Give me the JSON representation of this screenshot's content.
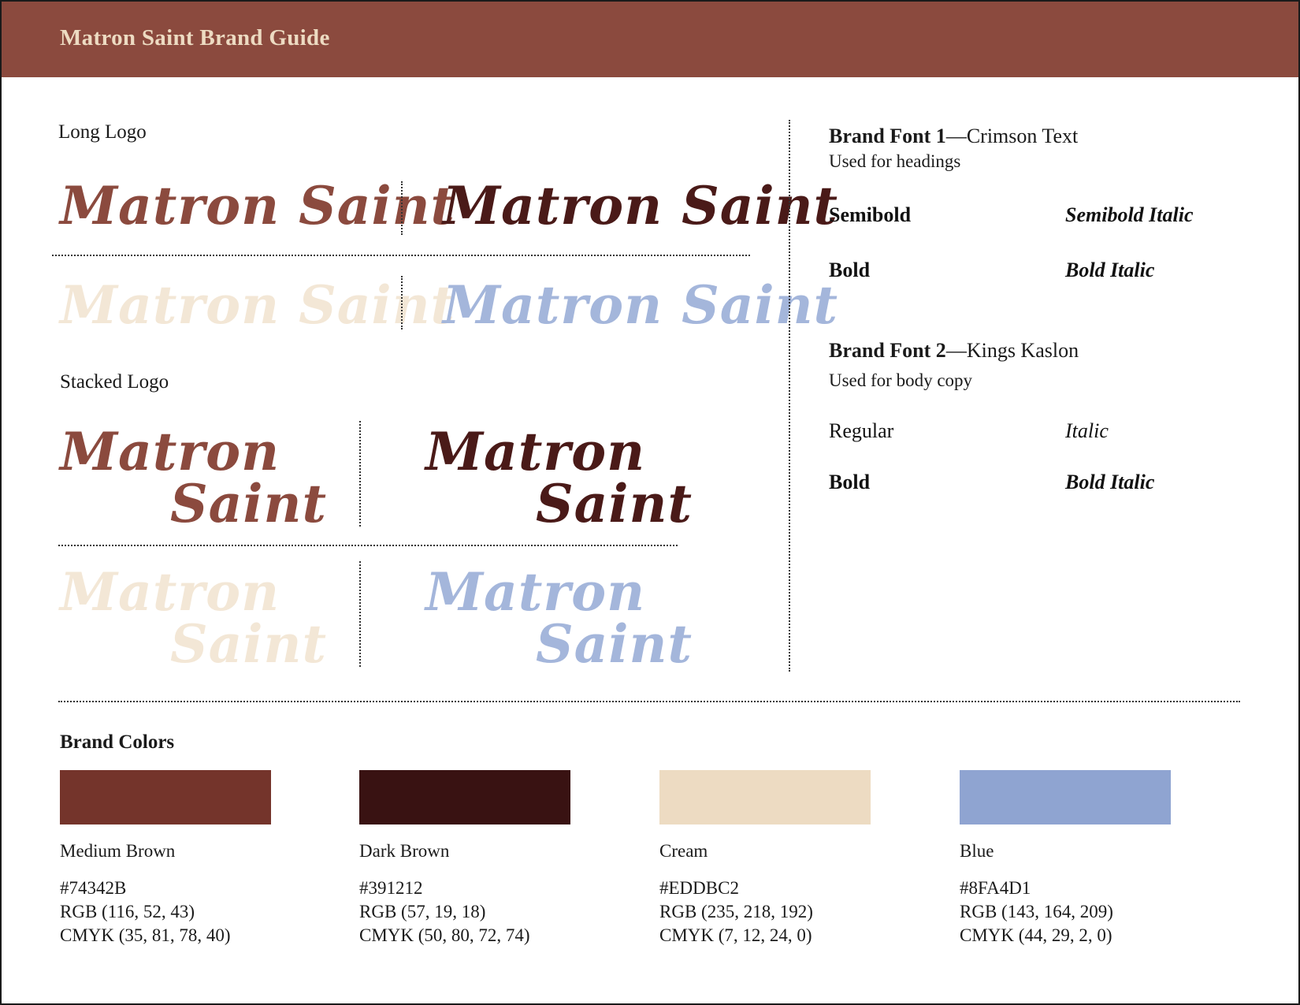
{
  "header": {
    "title": "Matron Saint Brand Guide"
  },
  "long_logo": {
    "label": "Long Logo",
    "text": "Matron Saint",
    "variants": [
      {
        "color": "#8B4A3E"
      },
      {
        "color": "#4A1A18"
      },
      {
        "color": "#F3E7D6"
      },
      {
        "color": "#A4B6DB"
      }
    ]
  },
  "stacked_logo": {
    "label": "Stacked Logo",
    "line1": "Matron",
    "line2": "Saint",
    "variants": [
      {
        "color": "#8B4A3E"
      },
      {
        "color": "#4A1A18"
      },
      {
        "color": "#F3E7D6"
      },
      {
        "color": "#A4B6DB"
      }
    ]
  },
  "fonts": [
    {
      "heading_bold": "Brand Font 1",
      "heading_name": "—Crimson Text",
      "usage": "Used for headings",
      "styles": [
        "Semibold",
        "Semibold Italic",
        "Bold",
        "Bold Italic"
      ]
    },
    {
      "heading_bold": "Brand Font 2",
      "heading_name": "—Kings Kaslon",
      "usage": "Used for body copy",
      "styles": [
        "Regular",
        "Italic",
        "Bold",
        "Bold Italic"
      ]
    }
  ],
  "brand_colors": {
    "label": "Brand Colors",
    "items": [
      {
        "name": "Medium Brown",
        "hex": "#74342B",
        "rgb": "RGB (116, 52, 43)",
        "cmyk": "CMYK (35, 81, 78, 40)",
        "swatch": "#74342B"
      },
      {
        "name": "Dark Brown",
        "hex": "#391212",
        "rgb": "RGB (57, 19, 18)",
        "cmyk": "CMYK (50, 80, 72, 74)",
        "swatch": "#391212"
      },
      {
        "name": "Cream",
        "hex": "#EDDBC2",
        "rgb": "RGB (235, 218, 192)",
        "cmyk": "CMYK (7, 12, 24, 0)",
        "swatch": "#EDDBC2"
      },
      {
        "name": "Blue",
        "hex": "#8FA4D1",
        "rgb": "RGB (143, 164, 209)",
        "cmyk": "CMYK (44, 29, 2, 0)",
        "swatch": "#8FA4D1"
      }
    ]
  }
}
